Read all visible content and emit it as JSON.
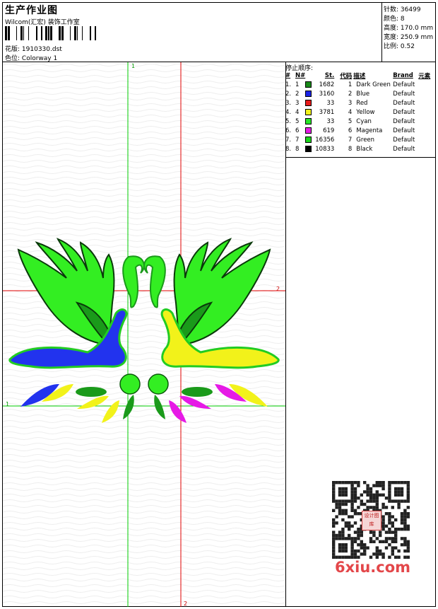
{
  "header": {
    "title": "生产作业图",
    "company": "Wilcom(汇宏) 装饰工作室",
    "design_label": "花版:",
    "design_value": "1910330.dst",
    "color_label": "色位:",
    "color_value": "Colorway 1"
  },
  "stats": [
    {
      "label": "针数:",
      "value": "36499"
    },
    {
      "label": "颜色:",
      "value": "8"
    },
    {
      "label": "高度:",
      "value": "170.0 mm"
    },
    {
      "label": "宽度:",
      "value": "250.9 mm"
    },
    {
      "label": "比例:",
      "value": "0.52"
    }
  ],
  "stop_sequence": {
    "title": "停止顺序:",
    "columns": [
      "#",
      "N#",
      "St.",
      "代码",
      "描述",
      "Brand",
      "元素"
    ],
    "rows": [
      {
        "idx": "1.",
        "n": "1",
        "color": "#1a8a1a",
        "st": "1682",
        "code": "1",
        "desc": "Dark Green",
        "brand": "Default"
      },
      {
        "idx": "2.",
        "n": "2",
        "color": "#1b24e6",
        "st": "3160",
        "code": "2",
        "desc": "Blue",
        "brand": "Default"
      },
      {
        "idx": "3.",
        "n": "3",
        "color": "#e81a1a",
        "st": "33",
        "code": "3",
        "desc": "Red",
        "brand": "Default"
      },
      {
        "idx": "4.",
        "n": "4",
        "color": "#f2f21a",
        "st": "3781",
        "code": "4",
        "desc": "Yellow",
        "brand": "Default"
      },
      {
        "idx": "5.",
        "n": "5",
        "color": "#26e626",
        "st": "33",
        "code": "5",
        "desc": "Cyan",
        "brand": "Default"
      },
      {
        "idx": "6.",
        "n": "6",
        "color": "#e61ae6",
        "st": "619",
        "code": "6",
        "desc": "Magenta",
        "brand": "Default"
      },
      {
        "idx": "7.",
        "n": "7",
        "color": "#1ad61a",
        "st": "16356",
        "code": "7",
        "desc": "Green",
        "brand": "Default"
      },
      {
        "idx": "8.",
        "n": "8",
        "color": "#000000",
        "st": "10833",
        "code": "8",
        "desc": "Black",
        "brand": "Default"
      }
    ]
  },
  "guides": {
    "v1": "1",
    "h1": "1",
    "h2": "2",
    "v2": "2"
  },
  "watermark": "6xiu.com",
  "qr_stamp_text": "设计图库"
}
